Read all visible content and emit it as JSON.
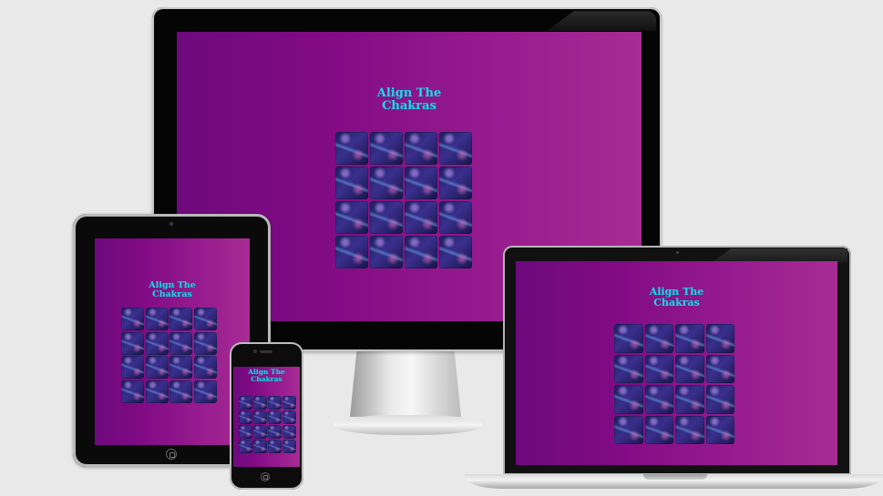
{
  "app": {
    "title_line1": "Align The",
    "title_line2": "Chakras"
  },
  "devices": {
    "monitor": {
      "title_line1": "Align The",
      "title_line2": "Chakras",
      "card_count": 16
    },
    "laptop": {
      "title_line1": "Align The",
      "title_line2": "Chakras",
      "card_count": 16
    },
    "tablet": {
      "title_line1": "Align The",
      "title_line2": "Chakras",
      "card_count": 16
    },
    "phone": {
      "title_line1": "Align The",
      "title_line2": "Chakras",
      "card_count": 16
    }
  },
  "icons": {
    "card_back": "cosmic-card-icon",
    "home_button": "home-button-icon"
  },
  "colors": {
    "background_start": "#6e0a7e",
    "background_end": "#a72c94",
    "title": "#22d4ee",
    "page": "#e9e9e9"
  }
}
